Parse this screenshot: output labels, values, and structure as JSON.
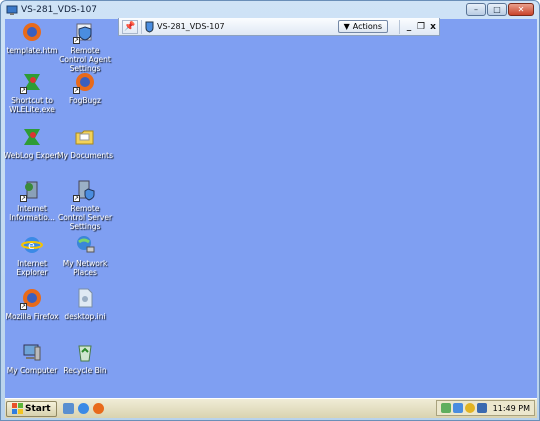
{
  "window": {
    "title": "VS-281_VDS-107",
    "controls": [
      "minimize-icon",
      "maximize-icon",
      "close-icon"
    ]
  },
  "connection_bar": {
    "pin_icon": "pin-icon",
    "title": "VS-281_VDS-107",
    "actions_label": "Actions",
    "min_glyph": "_",
    "restore_glyph": "❐",
    "close_glyph": "x"
  },
  "desktop_icons": [
    {
      "label": "template.htm",
      "icon": "firefox-document-icon"
    },
    {
      "label": "Remote Control Agent Settings",
      "icon": "shield-shortcut-icon"
    },
    {
      "label": "Shortcut to WLELite.exe",
      "icon": "wle-icon"
    },
    {
      "label": "FogBugz",
      "icon": "firefox-icon"
    },
    {
      "label": "WebLog Expert",
      "icon": "weblog-expert-icon"
    },
    {
      "label": "My Documents",
      "icon": "folder-icon"
    },
    {
      "label": "Internet Informatio...",
      "icon": "iis-icon"
    },
    {
      "label": "Remote Control Server Settings",
      "icon": "server-settings-icon"
    },
    {
      "label": "Internet Explorer",
      "icon": "internet-explorer-icon"
    },
    {
      "label": "My Network Places",
      "icon": "network-places-icon"
    },
    {
      "label": "Mozilla Firefox",
      "icon": "firefox-icon"
    },
    {
      "label": "desktop.ini",
      "icon": "ini-file-icon"
    },
    {
      "label": "My Computer",
      "icon": "my-computer-icon"
    },
    {
      "label": "Recycle Bin",
      "icon": "recycle-bin-icon"
    }
  ],
  "taskbar": {
    "start_label": "Start",
    "quick_launch": [
      "show-desktop-icon",
      "internet-explorer-icon",
      "firefox-icon"
    ],
    "tray_icons": [
      "network-icon",
      "vc-icon",
      "security-icon",
      "volume-icon"
    ],
    "clock": "11:49 PM"
  },
  "colors": {
    "desktop": "#7f9ff2",
    "taskbar": "#ece9d8"
  }
}
